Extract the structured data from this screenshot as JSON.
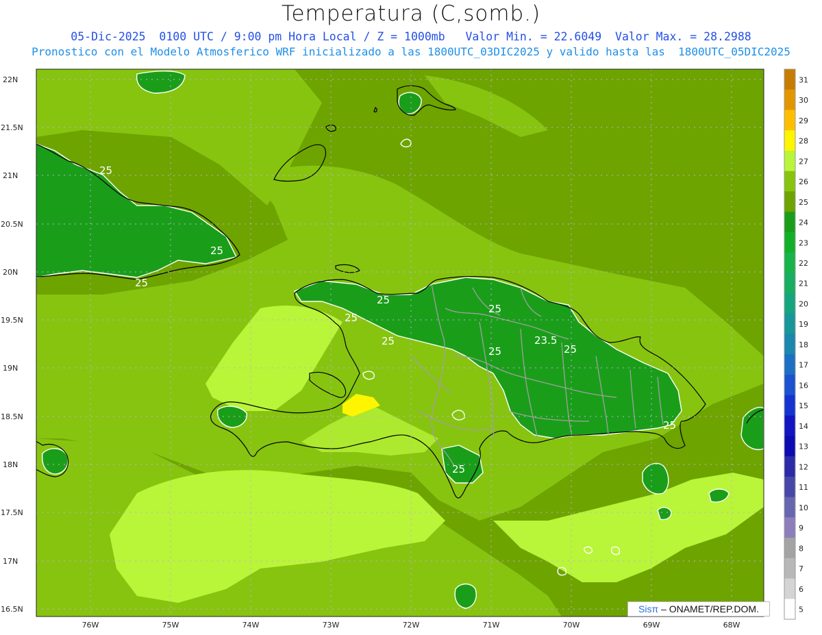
{
  "title": "Temperatura (C,somb.)",
  "subtitle1": "05-Dic-2025  0100 UTC / 9:00 pm Hora Local / Z = 1000mb   Valor Min. = 22.6049  Valor Max. = 28.2988",
  "subtitle2": "Pronostico con el Modelo Atmosferico WRF inicializado a las 1800UTC_03DIC2025 y valido hasta las  1800UTC_05DIC2025",
  "credit": {
    "brand": "Sisπ",
    "org": " – ONAMET/REP.DOM."
  },
  "lat_labels": [
    "22N",
    "21.5N",
    "21N",
    "20.5N",
    "20N",
    "19.5N",
    "19N",
    "18.5N",
    "18N",
    "17.5N",
    "17N",
    "16.5N"
  ],
  "lon_labels": [
    "76W",
    "75W",
    "74W",
    "73W",
    "72W",
    "71W",
    "70W",
    "69W",
    "68W"
  ],
  "contour_labels": [
    "25",
    "25",
    "25",
    "25",
    "25",
    "25",
    "25",
    "23.5",
    "25",
    "25",
    "25"
  ],
  "colorbar": {
    "levels": [
      "31",
      "30",
      "29",
      "28",
      "27",
      "26",
      "25",
      "24",
      "23",
      "22",
      "21",
      "20",
      "19",
      "18",
      "17",
      "16",
      "15",
      "14",
      "13",
      "12",
      "11",
      "10",
      "9",
      "8",
      "7",
      "6",
      "5"
    ],
    "colors": [
      "#c67c00",
      "#e39600",
      "#ffbf00",
      "#fff500",
      "#b9f538",
      "#87c410",
      "#6da400",
      "#1a9e1a",
      "#12b029",
      "#16b44a",
      "#18ad60",
      "#15a57f",
      "#17979a",
      "#1b86ae",
      "#1c6fc4",
      "#1a52cf",
      "#1533cf",
      "#1215c2",
      "#0c0cb2",
      "#2b2ba8",
      "#4747aa",
      "#6666b0",
      "#8d7ebb",
      "#a3a3a3",
      "#b8b8b8",
      "#d4d4d4",
      "#ffffff"
    ]
  },
  "colors": {
    "sea": "#6da400",
    "warm": "#87c410",
    "warmer": "#b9f538",
    "land": "#1a9e1a",
    "hot": "#fff500",
    "border": "#a0a0a0",
    "coast": "#000000",
    "grid": "#c9a6e8"
  }
}
